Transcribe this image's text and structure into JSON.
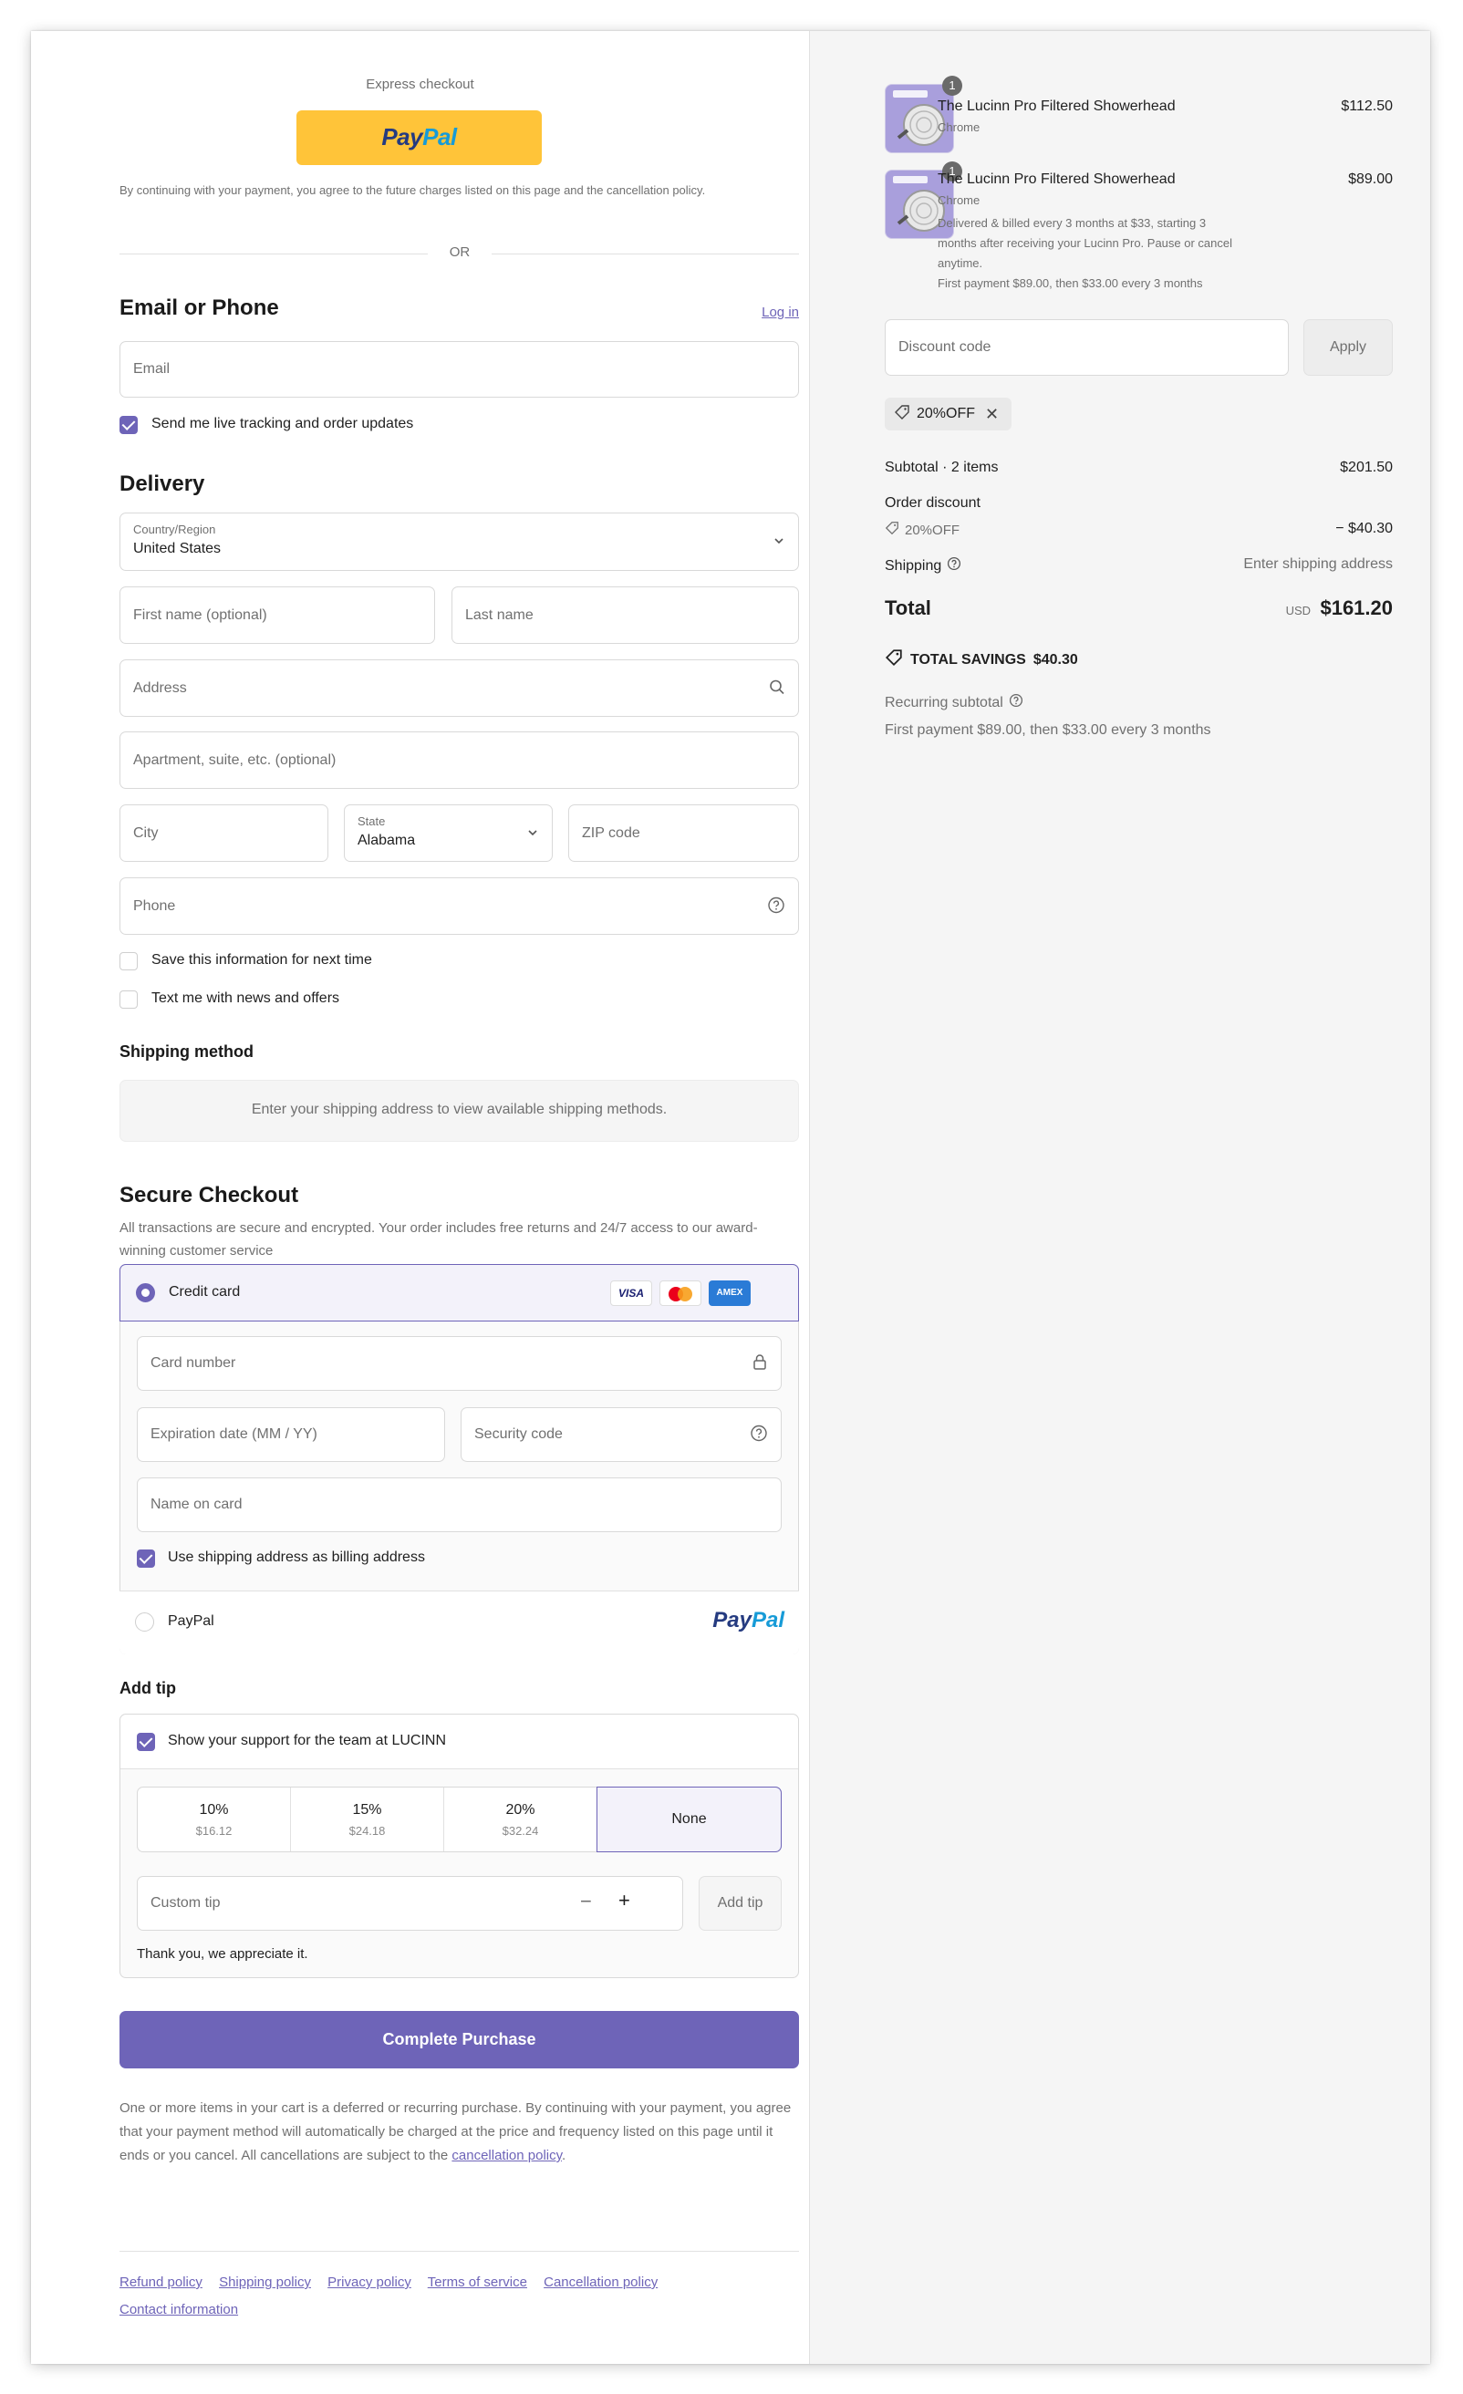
{
  "express": {
    "title": "Express checkout",
    "paypal_label": "PayPal",
    "consent": "By continuing with your payment, you agree to the future charges listed on this page and the cancellation policy.",
    "or": "OR"
  },
  "contact": {
    "heading": "Email or Phone",
    "login": "Log in",
    "email_placeholder": "Email",
    "tracking_label": "Send me live tracking and order updates"
  },
  "delivery": {
    "heading": "Delivery",
    "country_label": "Country/Region",
    "country_value": "United States",
    "first_name": "First name (optional)",
    "last_name": "Last name",
    "address": "Address",
    "apartment": "Apartment, suite, etc. (optional)",
    "city": "City",
    "state_label": "State",
    "state_value": "Alabama",
    "zip": "ZIP code",
    "phone": "Phone",
    "save_info": "Save this information for next time",
    "text_offers": "Text me with news and offers"
  },
  "shipping_method": {
    "heading": "Shipping method",
    "message": "Enter your shipping address to view available shipping methods."
  },
  "secure": {
    "heading": "Secure Checkout",
    "description": "All transactions are secure and encrypted. Your order includes free returns and 24/7 access to our award-winning customer service",
    "credit_card": "Credit card",
    "card_brands": [
      "VISA",
      "Mastercard",
      "AMEX"
    ],
    "card_number": "Card number",
    "expiration": "Expiration date (MM / YY)",
    "security_code": "Security code",
    "name_on_card": "Name on card",
    "use_shipping": "Use shipping address as billing address",
    "paypal": "PayPal",
    "paypal_logo": "PayPal"
  },
  "tip": {
    "heading": "Add tip",
    "support": "Show your support for the team at LUCINN",
    "options": [
      {
        "pct": "10%",
        "amount": "$16.12"
      },
      {
        "pct": "15%",
        "amount": "$24.18"
      },
      {
        "pct": "20%",
        "amount": "$32.24"
      },
      {
        "pct": "None",
        "amount": ""
      }
    ],
    "custom_placeholder": "Custom tip",
    "add_button": "Add tip",
    "thanks": "Thank you, we appreciate it."
  },
  "purchase": {
    "button": "Complete Purchase",
    "notice": "One or more items in your cart is a deferred or recurring purchase. By continuing with your payment, you agree that your payment method will automatically be charged at the price and frequency listed on this page until it ends or you cancel. All cancellations are subject to the",
    "notice_link": "cancellation policy",
    "notice_end": "."
  },
  "footer": {
    "links": [
      "Refund policy",
      "Shipping policy",
      "Privacy policy",
      "Terms of service",
      "Cancellation policy"
    ],
    "contact": "Contact information"
  },
  "cart": {
    "items": [
      {
        "qty": "1",
        "name": "The Lucinn Pro Filtered Showerhead",
        "variant": "Chrome",
        "price": "$112.50",
        "details": [],
        "first_payment": ""
      },
      {
        "qty": "1",
        "name": "The Lucinn Pro Filtered Showerhead",
        "variant": "Chrome",
        "price": "$89.00",
        "details": [
          "Delivered & billed every 3 months at $33, starting 3",
          "months after receiving your Lucinn Pro. Pause or cancel",
          "anytime."
        ],
        "first_payment": "First payment $89.00, then $33.00 every 3 months"
      }
    ],
    "discount_placeholder": "Discount code",
    "apply": "Apply",
    "applied_code": "20%OFF",
    "subtotal_label": "Subtotal · 2 items",
    "subtotal_value": "$201.50",
    "order_discount_label": "Order discount",
    "order_discount_code": "20%OFF",
    "order_discount_value": "− $40.30",
    "shipping_label": "Shipping",
    "shipping_value": "Enter shipping address",
    "total_label": "Total",
    "currency": "USD",
    "total_value": "$161.20",
    "savings_label": "TOTAL SAVINGS",
    "savings_value": "$40.30",
    "recurring_label": "Recurring subtotal",
    "recurring_value": "First payment $89.00, then $33.00 every 3 months"
  },
  "colors": {
    "accent": "#6e64b8",
    "paypal_yellow": "#ffc439",
    "panel_bg": "#f5f5f5"
  }
}
